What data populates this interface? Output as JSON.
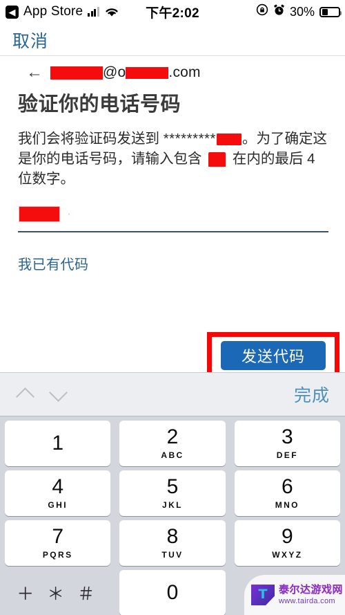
{
  "status_bar": {
    "back_icon": "chevron-left-icon",
    "carrier": "App Store",
    "signal_icon": "signal-bars-icon",
    "wifi_icon": "wifi-icon",
    "time": "下午2:02",
    "rotation_lock_icon": "rotation-lock-icon",
    "alarm_icon": "alarm-clock-icon",
    "battery_percent": "30%",
    "battery_icon": "battery-icon",
    "battery_level": 30
  },
  "nav": {
    "cancel_label": "取消"
  },
  "account_row": {
    "back_arrow_icon": "arrow-left-icon",
    "email_prefix_redacted": "",
    "email_at": "@o",
    "email_domain_redacted": "",
    "email_suffix": ".com"
  },
  "page": {
    "title": "验证你的电话号码",
    "body_part_1": "我们会将验证码发送到 ",
    "body_stars": "*********",
    "body_part_2": "。为了确定这是你的电话号码，请输入包含 ",
    "body_part_3": " 在内的最后 4 位数字。",
    "have_code_link": "我已有代码",
    "send_code_label": "发送代码"
  },
  "code_input": {
    "value_redacted": "",
    "placeholder": ""
  },
  "keyboard": {
    "accessory": {
      "prev_icon": "chevron-up-icon",
      "next_icon": "chevron-down-icon",
      "done_label": "完成"
    },
    "rows": [
      [
        {
          "digit": "1",
          "letters": ""
        },
        {
          "digit": "2",
          "letters": "ABC"
        },
        {
          "digit": "3",
          "letters": "DEF"
        }
      ],
      [
        {
          "digit": "4",
          "letters": "GHI"
        },
        {
          "digit": "5",
          "letters": "JKL"
        },
        {
          "digit": "6",
          "letters": "MNO"
        }
      ],
      [
        {
          "digit": "7",
          "letters": "PQRS"
        },
        {
          "digit": "8",
          "letters": "TUV"
        },
        {
          "digit": "9",
          "letters": "WXYZ"
        }
      ]
    ],
    "bottom_row": {
      "symbols_label": "＋ ＊ ＃",
      "zero_digit": "0"
    }
  },
  "watermark": {
    "logo_letter": "T",
    "site_name": "泰尔达游戏网",
    "site_url": "www.tairda.com"
  },
  "colors": {
    "link_blue": "#2a6496",
    "button_blue": "#1b69b6",
    "annotation_red": "#fa0505",
    "redaction_red": "#f40d0c",
    "keyboard_bg": "#d3d7dd",
    "accessory_bg": "#eceef1",
    "done_blue": "#4e90bd"
  }
}
